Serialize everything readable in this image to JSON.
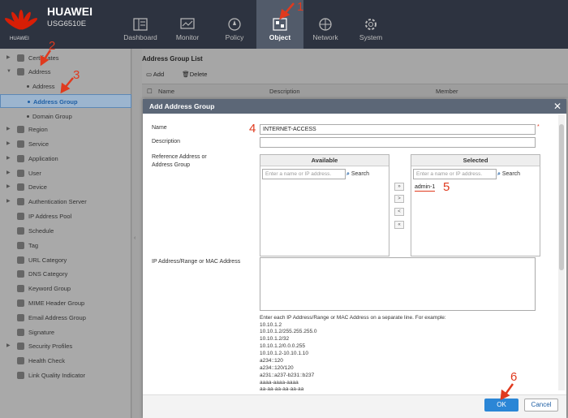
{
  "brand": {
    "logo_text": "HUAWEI",
    "name": "HUAWEI",
    "model": "USG6510E"
  },
  "nav": [
    {
      "label": "Dashboard",
      "icon": "dashboard-icon"
    },
    {
      "label": "Monitor",
      "icon": "monitor-icon"
    },
    {
      "label": "Policy",
      "icon": "policy-icon"
    },
    {
      "label": "Object",
      "icon": "object-icon",
      "active": true
    },
    {
      "label": "Network",
      "icon": "network-icon"
    },
    {
      "label": "System",
      "icon": "system-icon"
    }
  ],
  "sidebar": {
    "items": [
      "Certificates",
      "Address",
      "Address",
      "Address Group",
      "Domain Group",
      "Region",
      "Service",
      "Application",
      "User",
      "Device",
      "Authentication Server",
      "IP Address Pool",
      "Schedule",
      "Tag",
      "URL Category",
      "DNS Category",
      "Keyword Group",
      "MIME Header Group",
      "Email Address Group",
      "Signature",
      "Security Profiles",
      "Health Check",
      "Link Quality Indicator"
    ]
  },
  "main": {
    "title": "Address Group List",
    "add": "Add",
    "delete": "Delete",
    "columns": [
      "Name",
      "Description",
      "Member"
    ]
  },
  "modal": {
    "title": "Add Address Group",
    "name_label": "Name",
    "name_value": "INTERNET-ACCESS",
    "required_mark": "*",
    "desc_label": "Description",
    "ref_label": "Reference Address or Address Group",
    "available": "Available",
    "selected": "Selected",
    "search_ph": "Enter a name or IP address.",
    "search_btn": "Search",
    "selected_item": "admin-1",
    "ip_label": "IP Address/Range or MAC Address",
    "move": [
      "»",
      ">",
      "<",
      "«"
    ],
    "example_intro": "Enter each IP Address/Range or MAC Address on a separate line. For example:",
    "examples": [
      "10.10.1.2",
      "10.10.1.2/255.255.255.0",
      "10.10.1.2/32",
      "10.10.1.2/0.0.0.255",
      "10.10.1.2-10.10.1.10",
      "a234::120",
      "a234::120/120",
      "a231::a237-b231::b237",
      "aaaa-aaaa-aaaa",
      "aa-aa-aa-aa-aa-aa"
    ],
    "ok": "OK",
    "cancel": "Cancel"
  },
  "annotations": [
    "1",
    "2",
    "3",
    "4",
    "5",
    "6"
  ],
  "colors": {
    "annotation": "#e03a1e",
    "topbar": "#2d3340",
    "header": "#5c6777",
    "primary": "#2b86d6"
  }
}
